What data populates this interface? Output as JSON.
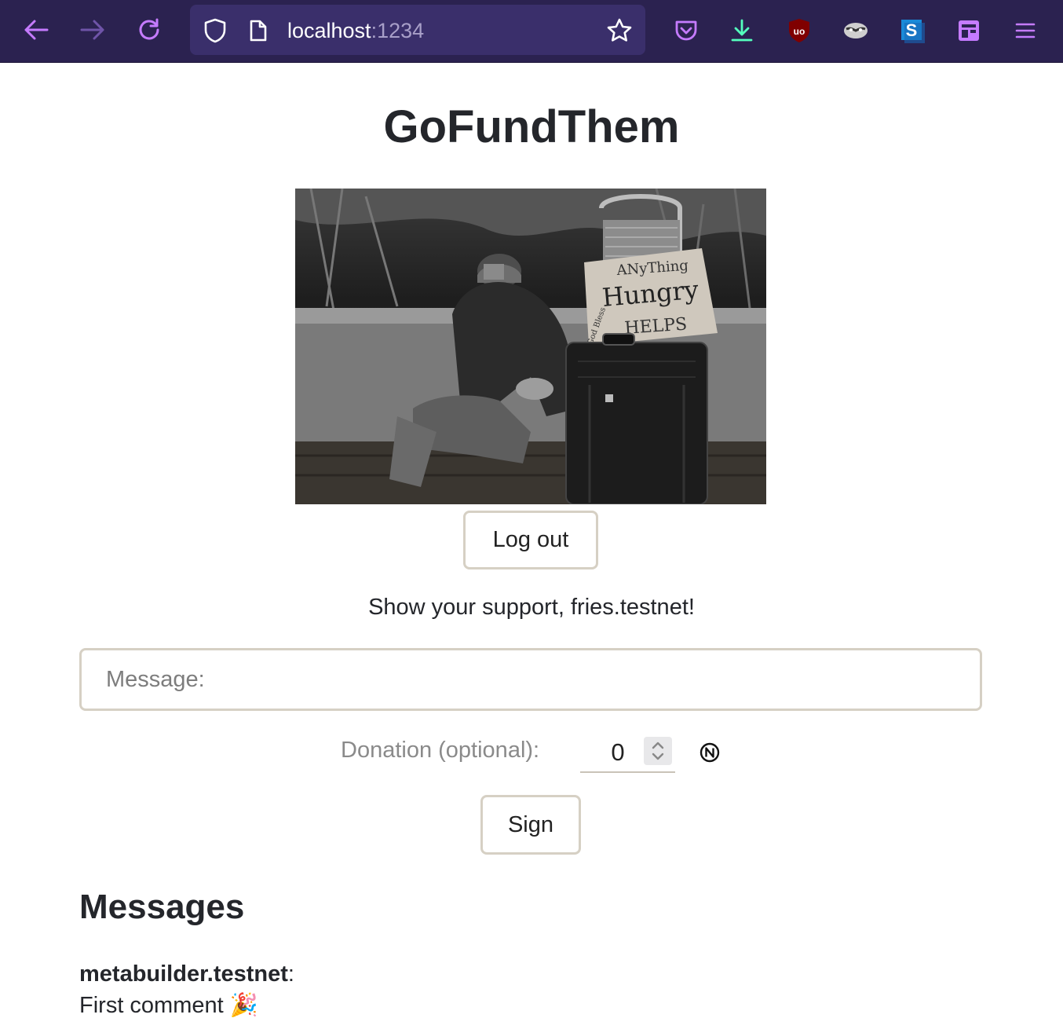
{
  "browser": {
    "url_host": "localhost",
    "url_port": ":1234",
    "icons": [
      "back-arrow-icon",
      "forward-arrow-icon",
      "reload-icon",
      "shield-icon",
      "page-icon",
      "bookmark-star-icon",
      "pocket-icon",
      "download-icon",
      "ublock-origin-icon",
      "privacy-badger-icon",
      "s-extension-icon",
      "extension-window-icon",
      "hamburger-menu-icon"
    ]
  },
  "page": {
    "title": "GoFundThem",
    "logout_label": "Log out",
    "support_text": "Show your support, fries.testnet!",
    "message_placeholder": "Message:",
    "donation_label": "Donation (optional):",
    "donation_value": "0",
    "currency_icon": "near-token-icon",
    "sign_label": "Sign"
  },
  "hero_image": {
    "sign_lines": [
      "ANyThing",
      "Hungry",
      "HELPS",
      "God Bless"
    ]
  },
  "messages": {
    "heading": "Messages",
    "items": [
      {
        "author": "metabuilder.testnet",
        "separator": ":",
        "text": "First comment 🎉"
      }
    ]
  },
  "colors": {
    "chrome_bg": "#2b2250",
    "urlbar_bg": "#3a2f6b",
    "accent_purple": "#c57bff",
    "download_green": "#54ffbd",
    "border_beige": "#d6d0c4"
  }
}
